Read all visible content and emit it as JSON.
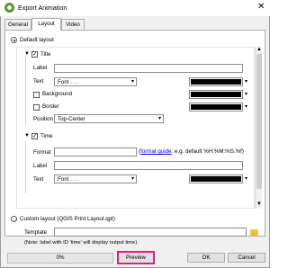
{
  "window": {
    "title": "Export Animation",
    "close_glyph": "✕"
  },
  "tabs": [
    "General",
    "Layout",
    "Video"
  ],
  "default_layout": {
    "label": "Default layout",
    "selected": true
  },
  "title_section": {
    "label": "Title",
    "checked": true,
    "label_field": {
      "label": "Label",
      "value": ""
    },
    "text": {
      "label": "Text",
      "font_button": "Font . . .",
      "color": "#000000"
    },
    "background": {
      "label": "Background",
      "checked": false,
      "color": "#000000"
    },
    "border": {
      "label": "Border",
      "checked": false,
      "color": "#000000"
    },
    "position": {
      "label": "Position",
      "value": "Top-Center"
    }
  },
  "time_section": {
    "label": "Time",
    "checked": true,
    "format": {
      "label": "Format",
      "value": "",
      "link": "format guide",
      "hint": ": e.g. default %H:%M:%S.%f)",
      "hint_open": "("
    },
    "label_field": {
      "label": "Label",
      "value": ""
    },
    "text": {
      "label": "Text",
      "font_button": "Font . . .",
      "color": "#000000"
    }
  },
  "custom_layout": {
    "label": "Custom layout (QGIS Print Layout.qpt)",
    "selected": false
  },
  "template": {
    "label": "Template",
    "value": ""
  },
  "note": "(Note: label with ID 'time' will display output time)",
  "progress": {
    "value": 0,
    "text": "0%"
  },
  "buttons": {
    "preview": "Preview",
    "ok": "OK",
    "cancel": "Cancel"
  },
  "colors": {
    "highlight": "#e0207a",
    "qgis_green": "#589632"
  }
}
